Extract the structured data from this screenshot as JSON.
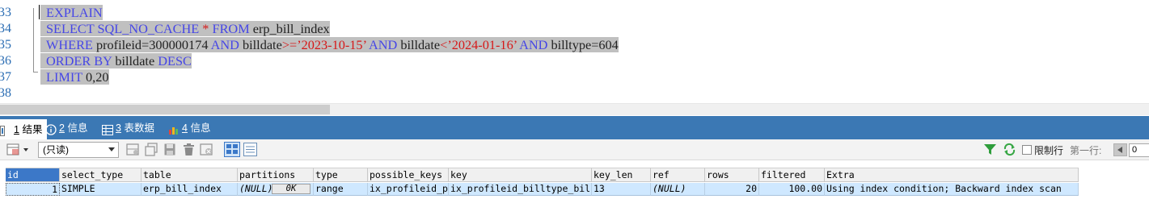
{
  "editor": {
    "line_numbers": [
      "33",
      "34",
      "35",
      "36",
      "37",
      "38"
    ],
    "lines": [
      [
        {
          "t": "EXPLAIN",
          "c": "kw"
        }
      ],
      [
        {
          "t": "SELECT ",
          "c": "kw"
        },
        {
          "t": "SQL_NO_CACHE ",
          "c": "kw"
        },
        {
          "t": "* ",
          "c": "op"
        },
        {
          "t": "FROM ",
          "c": "kw"
        },
        {
          "t": "erp_bill_index",
          "c": "id"
        }
      ],
      [
        {
          "t": "WHERE ",
          "c": "kw"
        },
        {
          "t": "profileid",
          "c": "id"
        },
        {
          "t": "=",
          "c": "id"
        },
        {
          "t": "300000174 ",
          "c": "id"
        },
        {
          "t": "AND ",
          "c": "kw"
        },
        {
          "t": "billdate",
          "c": "id"
        },
        {
          "t": ">=",
          "c": "op"
        },
        {
          "t": "’2023-10-15’ ",
          "c": "str"
        },
        {
          "t": "AND ",
          "c": "kw"
        },
        {
          "t": "billdate",
          "c": "id"
        },
        {
          "t": "<",
          "c": "op"
        },
        {
          "t": "’2024-01-16’ ",
          "c": "str"
        },
        {
          "t": "AND ",
          "c": "kw"
        },
        {
          "t": "billtype",
          "c": "id"
        },
        {
          "t": "=",
          "c": "id"
        },
        {
          "t": "604",
          "c": "id"
        }
      ],
      [
        {
          "t": "ORDER BY ",
          "c": "kw"
        },
        {
          "t": "billdate ",
          "c": "id"
        },
        {
          "t": "DESC",
          "c": "kw"
        }
      ],
      [
        {
          "t": "LIMIT ",
          "c": "kw"
        },
        {
          "t": "0,20",
          "c": "id"
        }
      ]
    ]
  },
  "tabs": [
    {
      "num": "1",
      "label": "结果",
      "icon": "result-grid-icon",
      "active": true
    },
    {
      "num": "2",
      "label": "信息",
      "icon": "info-icon",
      "active": false
    },
    {
      "num": "3",
      "label": "表数据",
      "icon": "table-data-icon",
      "active": false
    },
    {
      "num": "4",
      "label": "信息",
      "icon": "info-chart-icon",
      "active": false
    }
  ],
  "toolbar": {
    "mode_select": "(只读)",
    "limit_label": "限制行",
    "first_row_label": "第一行:",
    "first_row_value": "0"
  },
  "grid": {
    "columns": [
      "id",
      "select_type",
      "table",
      "partitions",
      "type",
      "possible_keys",
      "key",
      "key_len",
      "ref",
      "rows",
      "filtered",
      "Extra"
    ],
    "row": {
      "id": "1",
      "select_type": "SIMPLE",
      "table": "erp_bill_index",
      "partitions": "(NULL)",
      "partitions_btn": "0K",
      "type": "range",
      "possible_keys": "ix_profileid_p",
      "key": "ix_profileid_billtype_bil",
      "key_len": "13",
      "ref": "(NULL)",
      "rows": "20",
      "filtered": "100.00",
      "Extra": "Using index condition; Backward index scan"
    }
  },
  "colors": {
    "keyword": "#4646e6",
    "string": "#d61818",
    "line_number": "#2b6db3",
    "tab_bar": "#3b78b4",
    "selection": "#c0c0c0",
    "row_highlight": "#cfe8ff"
  }
}
